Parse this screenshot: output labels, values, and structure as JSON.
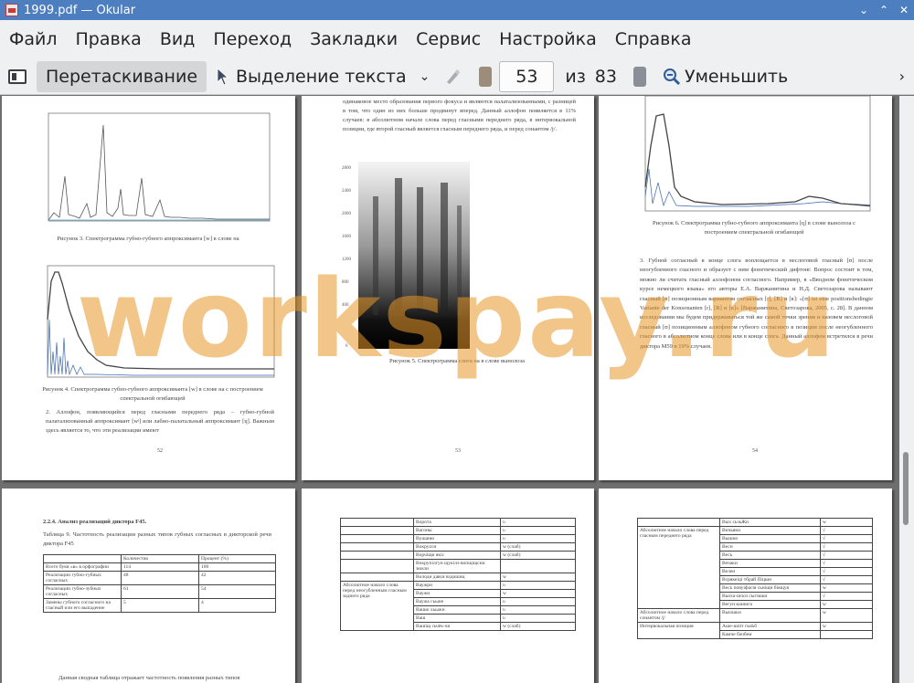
{
  "window": {
    "title": "1999.pdf  — Okular",
    "controls": [
      "⌄",
      "⌃",
      "✕"
    ]
  },
  "menubar": [
    "Файл",
    "Правка",
    "Вид",
    "Переход",
    "Закладки",
    "Сервис",
    "Настройка",
    "Справка"
  ],
  "toolbar": {
    "browse_label": "Перетаскивание",
    "select_label": "Выделение текста",
    "page_current": "53",
    "of_label": "из",
    "page_total": "83",
    "zoom_out_label": "Уменьшить"
  },
  "pages": {
    "p52": {
      "fig3_caption": "Рисунок 3. Спектрограмма губно-губного аппроксиманта [w] в слове на",
      "fig4_caption": "Рисунок 4. Спектрограмма губно-губного аппроксиманта [w] в слове на с построением спектральной огибающей",
      "body": "2. Аллофон, появляющийся перед гласными переднего ряда – губно-губной палатализованный аппроксимант [wʲ] или лабио-палатальный аппроксимант [ɥ]. Важным здесь является то, что эти реализации имеют",
      "number": "52"
    },
    "p53": {
      "body_top": "одинаковое место образования первого фокуса и являются палатализованными, с разницей в том, что один из них больше продвинут вперед. Данный аллофон появляется в 11% случаев: в абсолютном начале слова перед гласными переднего ряда, в интервокальной позиции, где второй гласный является гласным переднего ряда, и перед сонантом /j/.",
      "fig5_caption": "Рисунок 5. Спектрограмма слога на в слове вынолоза",
      "number": "53"
    },
    "p54": {
      "fig6_caption": "Рисунок 6. Спектрограмма губно-губного аппроксиманта [ɥ] в слове вынолоза с построением спектральной огибающей",
      "body": "3. Губной согласный в конце слога воплощается в неслоговой гласный [ʊ] после неогубленного гласного и образует с ним фонетический дифтонг. Вопрос состоит в том, можно ли считать гласный аллофоном согласного. Например, в «Вводном фонетическом курсе немецкого языка» его авторы Е.А. Варжанитина и Н.Д. Светозарова называют гласный [ʊ] позиционным вариантом согласных [r], [R] и [ʀ]: «[ʊ] ist eine positionsbedingte Variante der Konsonanten [r], [R] и [ʀ]» [Варжанитина, Светозарова, 2005, с. 28]. В данном исследовании мы будем придерживаться той же самой точки зрения и назовем неслоговой гласный [ʊ] позиционным аллофоном губного согласного в позиции после неогубленного гласного в абсолютном конце слова или в конце слога. Данный аллофон встретился в речи диктора M59 в 19% случаев.",
      "number": "54"
    },
    "p55": {
      "heading": "2.2.4. Анализ реализаций диктора F45.",
      "table_intro": "Таблица 9. Частотность реализации разных типов губных согласных в дикторской речи диктора F45",
      "table_header": [
        "",
        "Количество",
        "Процент (%)"
      ],
      "table_rows": [
        [
          "Всего букв «в» в орфографии",
          "114",
          "100"
        ],
        [
          "Реализации губно-губных согласных",
          "48",
          "42"
        ],
        [
          "Реализации губно-зубных согласных",
          "61",
          "54"
        ],
        [
          "Замены губного согласного на гласный или его выпадение",
          "5",
          "4"
        ]
      ],
      "body": "Данная сводная таблица отражает частотность появления разных типов"
    },
    "p56": {
      "group_label": "Абсолютное начало слова перед неогубленным гласным заднего ряда",
      "rows": [
        [
          "Ворота",
          "υ"
        ],
        [
          "Вагоны",
          "υ"
        ],
        [
          "Вушаню",
          "υ"
        ],
        [
          "Вокруzcи",
          "w (слаб)"
        ],
        [
          "Ворчiщи якiс",
          "w (слаб)"
        ],
        [
          "Вокрупiлгун щукiлз-вопщiщсни зюкзи",
          ""
        ],
        [
          "Володи дався вздишиц",
          "w"
        ],
        [
          "Ваужри",
          "υ"
        ],
        [
          "Ваужи",
          "w"
        ],
        [
          "Ваужа сьыне",
          "υ"
        ],
        [
          "Вашю хьыжи",
          "υ"
        ],
        [
          "Ваш",
          "υ"
        ],
        [
          "Вашiщ сьчёк-чя",
          "w (слаб)"
        ]
      ]
    },
    "p57": {
      "group1_label": "Абсолютное начало слова перед гласным переднего ряда",
      "group2_label": "Абсолютное начало слова перед сонантом /j/",
      "group3_label": "Интервокальная позиция",
      "rows": [
        [
          "Вых сьзьЖи",
          "w"
        ],
        [
          "Вичьяки",
          "√"
        ],
        [
          "Вышно",
          "√"
        ],
        [
          "Весн",
          "√"
        ],
        [
          "Весь",
          "√"
        ],
        [
          "Вечаки",
          "√"
        ],
        [
          "Велеи",
          "√"
        ],
        [
          "Всрякеіцi тбрай Піцшн",
          "√"
        ],
        [
          "Весь повуіфасiя сьніщн біящуя",
          "w"
        ],
        [
          "Вьиха-шчоз сыrзшки",
          "√"
        ],
        [
          "Вегун кшиига",
          "w"
        ],
        [
          "Вьвзшки",
          "w"
        ],
        [
          "Аше-шпіт гьчЬб",
          "w"
        ],
        [
          "Камче бачбем",
          ""
        ]
      ]
    }
  },
  "watermark": "workspay.ru"
}
